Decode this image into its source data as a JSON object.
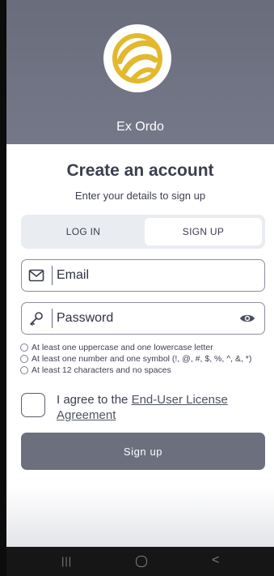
{
  "app": {
    "name": "Ex Ordo",
    "logo_icon": "ex-ordo-logo",
    "brand_color": "#e3b82d"
  },
  "form": {
    "title": "Create an account",
    "subtitle": "Enter your details to sign up",
    "tabs": [
      {
        "label": "LOG IN",
        "selected": false
      },
      {
        "label": "SIGN UP",
        "selected": true
      }
    ],
    "email": {
      "placeholder": "Email",
      "value": "",
      "icon": "envelope-icon"
    },
    "password": {
      "placeholder": "Password",
      "value": "",
      "icon": "key-icon",
      "toggle_icon": "eye-icon"
    },
    "password_rules": [
      "At least one uppercase and one lowercase letter",
      "At least one number and one symbol (!, @, #, $, %, ^, &, *)",
      "At least 12 characters and no spaces"
    ],
    "agree": {
      "prefix": "I agree to the ",
      "link": "End-User License Agreement",
      "checked": false
    },
    "submit_label": "Sign up"
  },
  "colors": {
    "header_bg": "#6a6d7c",
    "button_bg": "#6c6f7e",
    "tab_track": "#e9ecf1"
  },
  "navbar": {
    "recents_icon": "recents-icon",
    "home_icon": "home-icon",
    "back_icon": "back-icon",
    "recents_glyph": "|||",
    "back_glyph": "<"
  }
}
